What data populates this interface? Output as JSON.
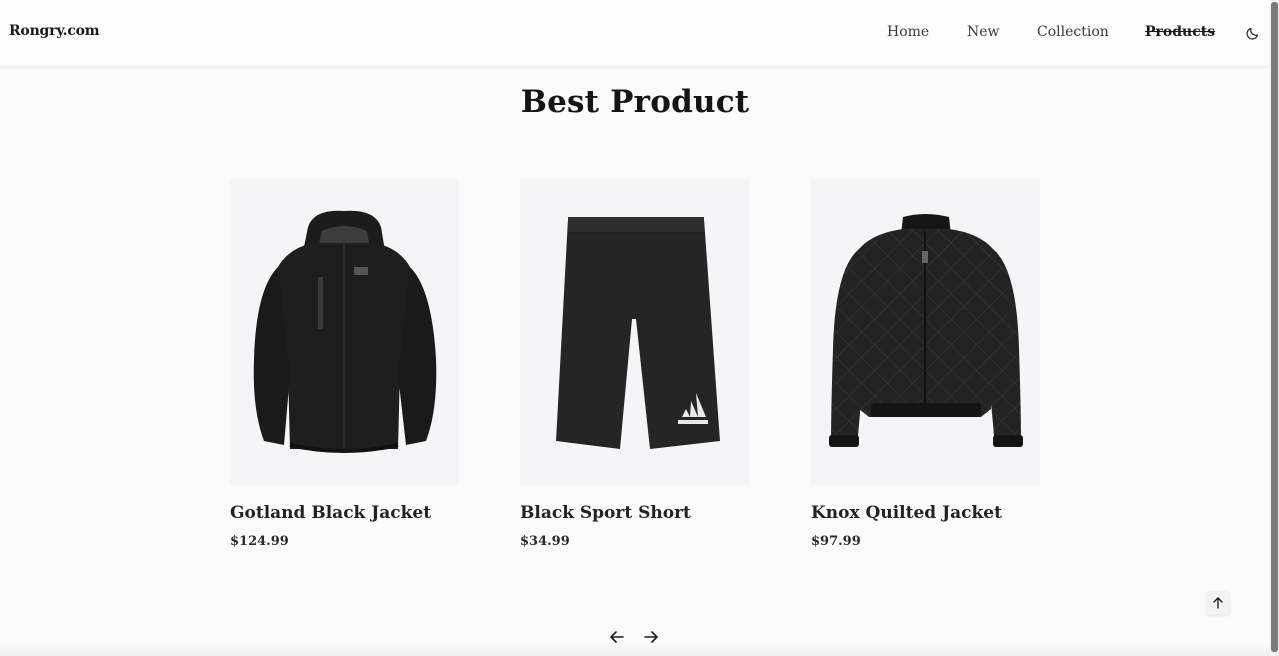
{
  "header": {
    "logo": "Rongry.com",
    "nav": {
      "home": "Home",
      "new": "New",
      "collection": "Collection",
      "products": "Products"
    },
    "theme_icon": "moon-icon"
  },
  "section": {
    "title": "Best Product"
  },
  "products": [
    {
      "name": "Gotland Black Jacket",
      "price": "$124.99",
      "image": "hooded-jacket"
    },
    {
      "name": "Black Sport Short",
      "price": "$34.99",
      "image": "sport-shorts"
    },
    {
      "name": "Knox Quilted Jacket",
      "price": "$97.99",
      "image": "quilted-jacket"
    }
  ],
  "pager": {
    "prev_icon": "arrow-left-icon",
    "next_icon": "arrow-right-icon"
  },
  "scroll_top_icon": "arrow-up-icon"
}
